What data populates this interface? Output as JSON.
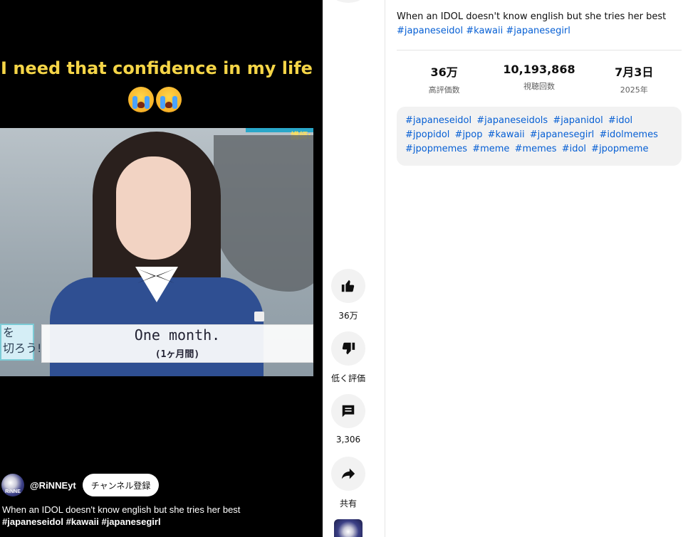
{
  "player": {
    "caption": "I need that confidence in my life",
    "frame": {
      "corner_tag": "講師:",
      "sign_text": "を\n切ろう!",
      "subtitle_en": "One month.",
      "subtitle_jp": "(1ヶ月間)"
    },
    "channel_avatar_text": "RiNNE",
    "channel_name": "@RiNNEyt",
    "subscribe_label": "チャンネル登録",
    "title": "When an IDOL doesn't know english but she tries her best",
    "hashtags": "#japaneseidol #kawaii #japanesegirl"
  },
  "actions": {
    "like_count": "36万",
    "dislike_label": "低く評価",
    "comment_count": "3,306",
    "share_label": "共有"
  },
  "description": {
    "title": "When an IDOL doesn't know english but she tries her best",
    "hashtags": "#japaneseidol #kawaii #japanesegirl",
    "stats": [
      {
        "value": "36万",
        "label": "高評価数"
      },
      {
        "value": "10,193,868",
        "label": "視聴回数"
      },
      {
        "value": "7月3日",
        "label": "2025年"
      }
    ],
    "tags": [
      "#japaneseidol",
      "#japaneseidols",
      "#japanidol",
      "#idol",
      "#jpopidol",
      "#jpop",
      "#kawaii",
      "#japanesegirl",
      "#idolmemes",
      "#jpopmemes",
      "#meme",
      "#memes",
      "#idol",
      "#jpopmeme"
    ]
  },
  "colors": {
    "caption": "#f5d547",
    "link": "#065fd4"
  },
  "icons": [
    "like-icon",
    "dislike-icon",
    "comment-icon",
    "share-icon",
    "crying-emoji-icon"
  ]
}
